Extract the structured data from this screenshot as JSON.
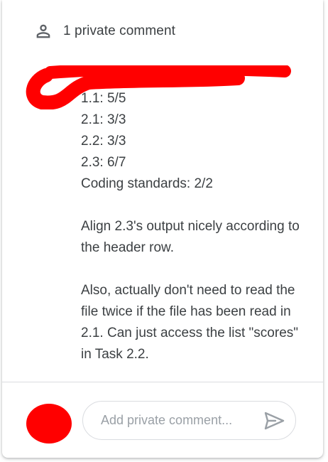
{
  "header": {
    "title": "1 private comment",
    "icon": "person-outline-icon"
  },
  "comment": {
    "lines": [
      "1.1: 5/5",
      "2.1: 3/3",
      "2.2: 3/3",
      "2.3: 6/7",
      "Coding standards: 2/2"
    ],
    "paragraph_1": "Align 2.3's output nicely according to the header row.",
    "paragraph_2": "Also, actually don't need to read the file twice if the file has been read in 2.1. Can just access the list \"scores\" in Task 2.2."
  },
  "composer": {
    "placeholder": "Add private comment...",
    "send_icon": "send-icon"
  },
  "colors": {
    "text": "#3c4043",
    "icon": "#5f6368",
    "redaction": "#ff0000",
    "divider": "#dadce0"
  }
}
